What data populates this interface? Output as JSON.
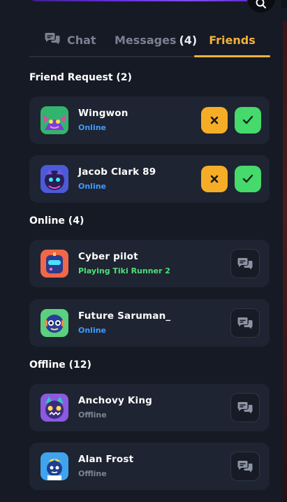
{
  "tabs": [
    {
      "label": "Chat"
    },
    {
      "label": "Messages",
      "count": "(4)"
    },
    {
      "label": "Friends"
    }
  ],
  "sections": {
    "requests": {
      "title": "Friend Request (2)"
    },
    "online": {
      "title": "Online (4)"
    },
    "offline": {
      "title": "Offline (12)"
    }
  },
  "friend_requests": [
    {
      "name": "Wingwon",
      "status": "Online"
    },
    {
      "name": "Jacob Clark 89",
      "status": "Online"
    }
  ],
  "online_friends": [
    {
      "name": "Cyber pilot",
      "status": "Playing Tiki Runner 2"
    },
    {
      "name": "Future Saruman_",
      "status": "Online"
    }
  ],
  "offline_friends": [
    {
      "name": "Anchovy King",
      "status": "Offline"
    },
    {
      "name": "Alan Frost",
      "status": "Offline"
    }
  ],
  "icons": {
    "search": "search-icon",
    "chat_tab": "chat-bubbles-icon",
    "decline": "close-icon",
    "accept": "check-icon",
    "message": "chat-bubbles-icon"
  },
  "colors": {
    "accent": "#f2b13a",
    "online": "#3f9bff",
    "playing": "#4fe07a",
    "offline": "#7e8595",
    "decline": "#f5ad27",
    "accept": "#46d96b"
  }
}
